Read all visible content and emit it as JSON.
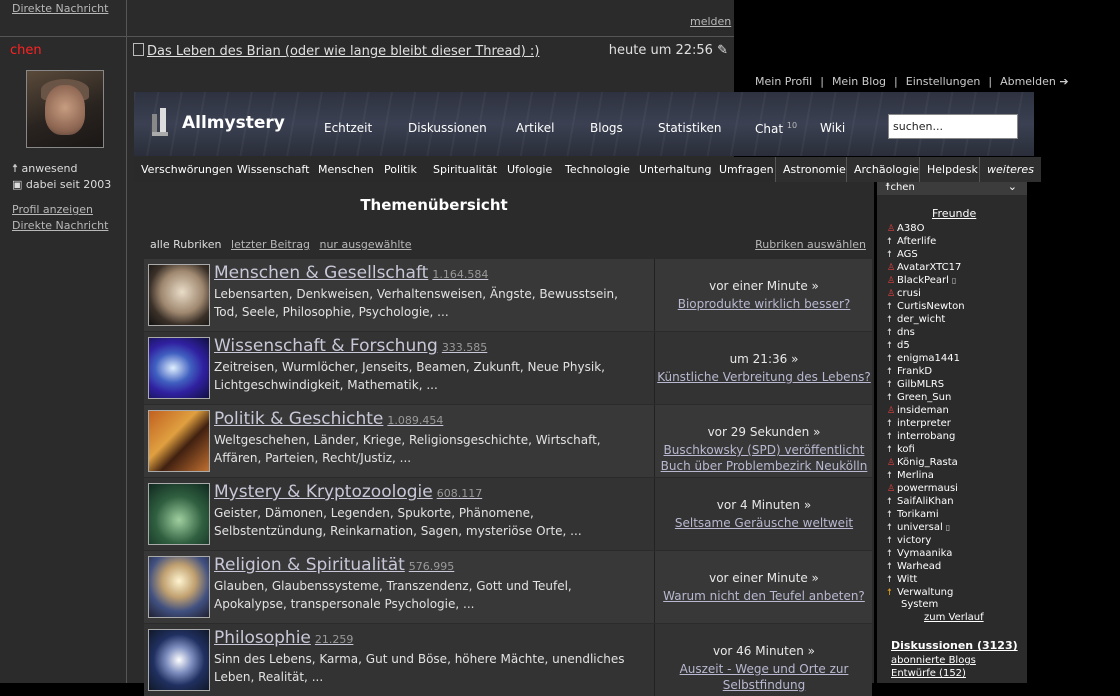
{
  "post": {
    "top_message_link": "Direkte Nachricht",
    "report_link": "melden",
    "username": "chen",
    "status_online": "anwesend",
    "member_since": "dabei seit 2003",
    "profile_link": "Profil anzeigen",
    "message_link": "Direkte Nachricht",
    "thread_title": "Das Leben des Brian (oder wie lange bleibt dieser Thread) :)",
    "thread_date": "heute um 22:56"
  },
  "user_links": [
    "Mein Profil",
    "Mein Blog",
    "Einstellungen",
    "Abmelden ➔"
  ],
  "header": {
    "logo_text": "Allmystery",
    "nav": [
      "Echtzeit",
      "Diskussionen",
      "Artikel",
      "Blogs",
      "Statistiken",
      "Chat",
      "Wiki"
    ],
    "chat_count": "10",
    "search_value": "suchen..."
  },
  "subnav": [
    "Verschwörungen",
    "Wissenschaft",
    "Menschen",
    "Politik",
    "Spiritualität",
    "Ufologie",
    "Technologie",
    "Unterhaltung",
    "Umfragen",
    "Astronomie",
    "Archäologie",
    "Helpdesk",
    "weiteres"
  ],
  "page_title": "Themenübersicht",
  "filters": {
    "all": "alle Rubriken",
    "last": "letzter Beitrag",
    "selected": "nur ausgewählte",
    "choose": "Rubriken auswählen"
  },
  "categories": [
    {
      "name": "Menschen & Gesellschaft",
      "count": "1.164.584",
      "desc": "Lebensarten, Denkweisen, Verhaltensweisen, Ängste, Bewusstsein, Tod, Seele, Philosophie, Psychologie, ...",
      "when": "vor einer Minute »",
      "last": "Bioprodukte wirklich besser?"
    },
    {
      "name": "Wissenschaft & Forschung",
      "count": "333.585",
      "desc": "Zeitreisen, Wurmlöcher, Jenseits, Beamen, Zukunft, Neue Physik, Lichtgeschwindigkeit, Mathematik, ...",
      "when": "um 21:36 »",
      "last": "Künstliche Verbreitung des Lebens?"
    },
    {
      "name": "Politik & Geschichte",
      "count": "1.089.454",
      "desc": "Weltgeschehen, Länder, Kriege, Religionsgeschichte, Wirtschaft, Affären, Parteien, Recht/Justiz, ...",
      "when": "vor 29 Sekunden »",
      "last": "Buschkowsky (SPD) veröffentlicht Buch über Problembezirk Neukölln"
    },
    {
      "name": "Mystery & Kryptozoologie",
      "count": "608.117",
      "desc": "Geister, Dämonen, Legenden, Spukorte, Phänomene, Selbstentzündung, Reinkarnation, Sagen, mysteriöse Orte, ...",
      "when": "vor 4 Minuten »",
      "last": "Seltsame Geräusche weltweit"
    },
    {
      "name": "Religion & Spiritualität",
      "count": "576.995",
      "desc": "Glauben, Glaubenssysteme, Transzendenz, Gott und Teufel, Apokalypse, transpersonale Psychologie, ...",
      "when": "vor einer Minute »",
      "last": "Warum nicht den Teufel anbeten?"
    },
    {
      "name": "Philosophie",
      "count": "21.259",
      "desc": "Sinn des Lebens, Karma, Gut und Böse, höhere Mächte, unendliches Leben, Realität, ...",
      "when": "vor 46 Minuten »",
      "last": "Auszeit - Wege und Orte zur Selbstfindung"
    }
  ],
  "sidebar": {
    "user": "chen",
    "friends_title": "Freunde",
    "friends": [
      {
        "name": "A38O",
        "state": "red"
      },
      {
        "name": "Afterlife",
        "state": "online"
      },
      {
        "name": "AGS",
        "state": "online"
      },
      {
        "name": "AvatarXTC17",
        "state": "red"
      },
      {
        "name": "BlackPearl",
        "state": "red",
        "phone": true
      },
      {
        "name": "crusi",
        "state": "red"
      },
      {
        "name": "CurtisNewton",
        "state": "online"
      },
      {
        "name": "der_wicht",
        "state": "online"
      },
      {
        "name": "dns",
        "state": "online"
      },
      {
        "name": "d5",
        "state": "online"
      },
      {
        "name": "enigma1441",
        "state": "online"
      },
      {
        "name": "FrankD",
        "state": "online"
      },
      {
        "name": "GilbMLRS",
        "state": "online"
      },
      {
        "name": "Green_Sun",
        "state": "online"
      },
      {
        "name": "insideman",
        "state": "red"
      },
      {
        "name": "interpreter",
        "state": "online"
      },
      {
        "name": "interrobang",
        "state": "online"
      },
      {
        "name": "kofi",
        "state": "online"
      },
      {
        "name": "König_Rasta",
        "state": "red"
      },
      {
        "name": "Merlina",
        "state": "online"
      },
      {
        "name": "powermausi",
        "state": "red"
      },
      {
        "name": "SaifAliKhan",
        "state": "online"
      },
      {
        "name": "Torikami",
        "state": "online"
      },
      {
        "name": "universal",
        "state": "online",
        "phone": true
      },
      {
        "name": "victory",
        "state": "online"
      },
      {
        "name": "Vymaanika",
        "state": "online"
      },
      {
        "name": "Warhead",
        "state": "online"
      },
      {
        "name": "Witt",
        "state": "online"
      },
      {
        "name": "Verwaltung",
        "state": "gold"
      }
    ],
    "system": "System",
    "history_link": "zum Verlauf",
    "discussions": "Diskussionen (3123)",
    "blogs": "abonnierte Blogs",
    "drafts": "Entwürfe (152)"
  },
  "colors": {
    "username": "#ff2222",
    "offline_icon": "#e04040",
    "admin_icon": "#e0a020"
  }
}
